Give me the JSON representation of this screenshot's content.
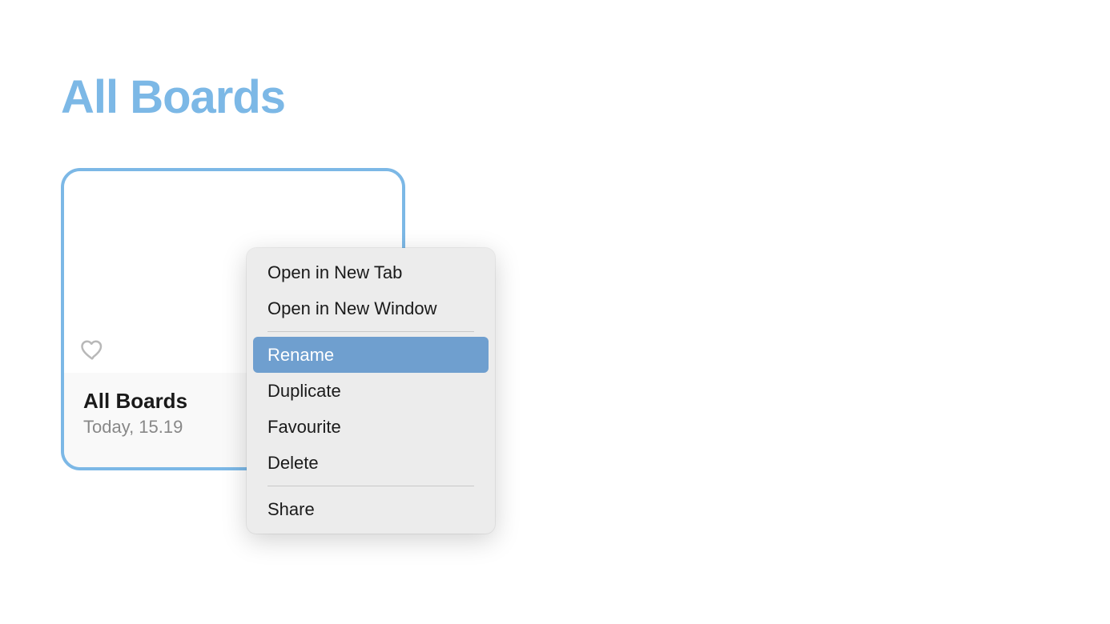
{
  "header": {
    "title": "All Boards"
  },
  "board": {
    "name": "All Boards",
    "timestamp": "Today, 15.19"
  },
  "context_menu": {
    "groups": [
      [
        {
          "label": "Open in New Tab",
          "highlighted": false
        },
        {
          "label": "Open in New Window",
          "highlighted": false
        }
      ],
      [
        {
          "label": "Rename",
          "highlighted": true
        },
        {
          "label": "Duplicate",
          "highlighted": false
        },
        {
          "label": "Favourite",
          "highlighted": false
        },
        {
          "label": "Delete",
          "highlighted": false
        }
      ],
      [
        {
          "label": "Share",
          "highlighted": false
        }
      ]
    ]
  }
}
